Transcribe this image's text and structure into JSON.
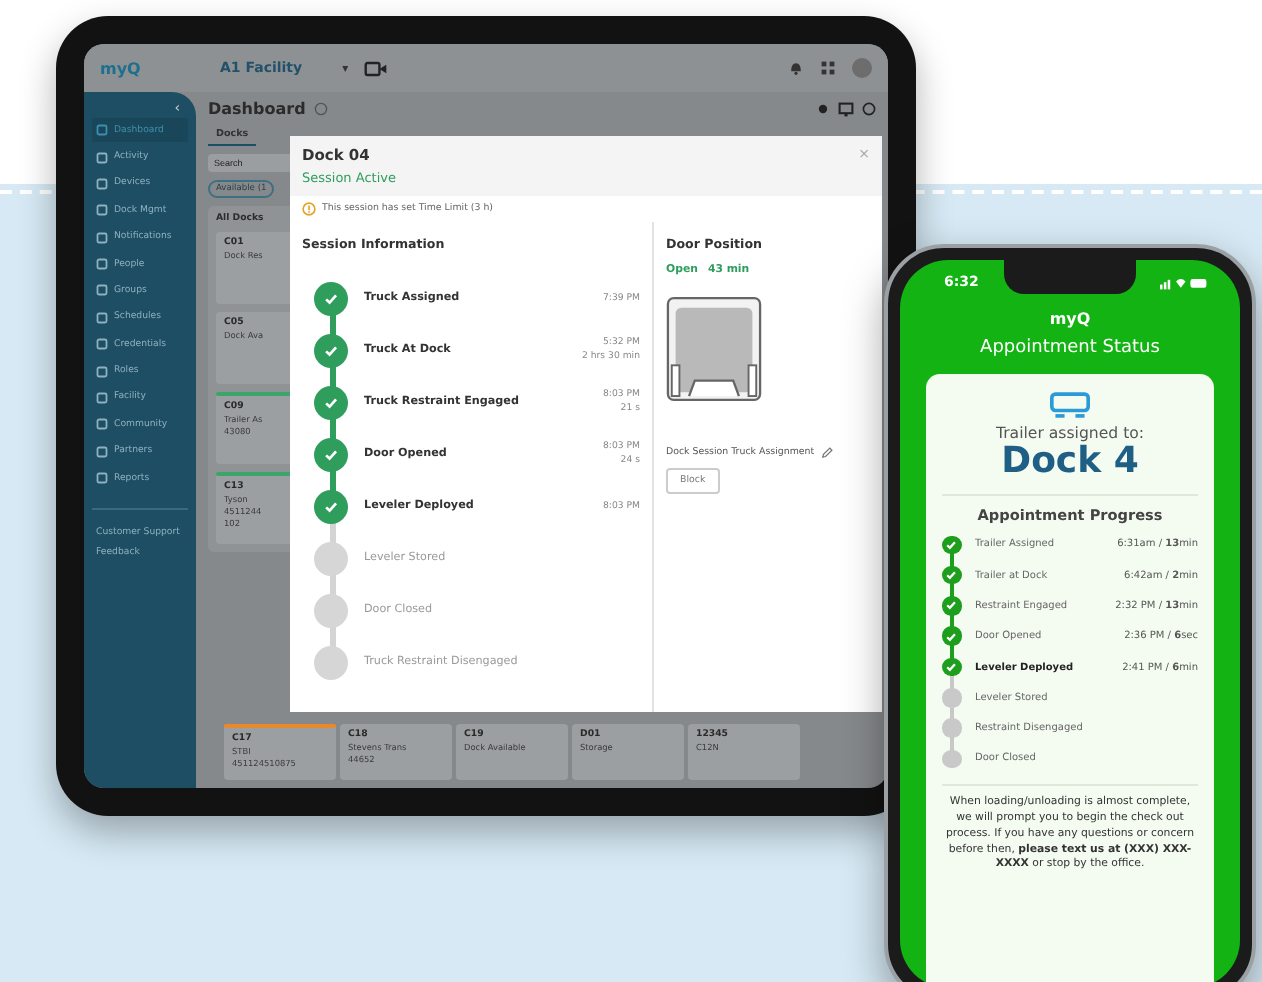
{
  "tablet": {
    "header": {
      "logo": "myQ",
      "facility": "A1 Facility",
      "caret": "▾"
    },
    "sidebar": {
      "collapse": "‹",
      "items": [
        {
          "label": "Dashboard",
          "selected": true
        },
        {
          "label": "Activity",
          "selected": false
        },
        {
          "label": "Devices",
          "selected": false
        },
        {
          "label": "Dock Mgmt",
          "selected": false
        },
        {
          "label": "Notifications",
          "selected": false
        },
        {
          "label": "People",
          "selected": false
        },
        {
          "label": "Groups",
          "selected": false
        },
        {
          "label": "Schedules",
          "selected": false
        },
        {
          "label": "Credentials",
          "selected": false
        },
        {
          "label": "Roles",
          "selected": false
        },
        {
          "label": "Facility",
          "selected": false
        },
        {
          "label": "Community",
          "selected": false
        },
        {
          "label": "Partners",
          "selected": false
        },
        {
          "label": "Reports",
          "selected": false
        }
      ],
      "footer_links": [
        "Customer Support",
        "Feedback"
      ]
    },
    "page_title": "Dashboard",
    "tabs": [
      {
        "label": "Docks",
        "selected": true
      }
    ],
    "search_placeholder": "Search",
    "filter_chip": "Available (1",
    "section_label": "All Docks",
    "dock_cards": [
      {
        "code": "C01",
        "lines": [
          "Dock Res"
        ]
      },
      {
        "code": "C05",
        "lines": [
          "Dock Ava"
        ]
      },
      {
        "code": "C09",
        "lines": [
          "Trailer As",
          "43080"
        ],
        "color": "#3aa66a"
      },
      {
        "code": "C13",
        "lines": [
          "Tyson",
          "4511244",
          "102"
        ],
        "color": "#3aa66a"
      }
    ],
    "bottom_cards": [
      {
        "code": "C17",
        "lines": [
          "STBI",
          "451124510875"
        ],
        "color": "#e8892c"
      },
      {
        "code": "C18",
        "lines": [
          "Stevens Trans",
          "44652"
        ]
      },
      {
        "code": "C19",
        "lines": [
          "Dock Available"
        ]
      },
      {
        "code": "D01",
        "lines": [
          "Storage"
        ]
      },
      {
        "code": "12345",
        "lines": [
          "C12N"
        ]
      }
    ],
    "modal": {
      "title": "Dock 04",
      "status": "Session Active",
      "notice": "This session has set Time Limit (3 h)",
      "close": "×",
      "section": "Session Information",
      "steps": [
        {
          "label": "Truck Assigned",
          "done": true,
          "time": "7:39 PM"
        },
        {
          "label": "Truck At Dock",
          "done": true,
          "time": "5:32 PM",
          "duration": "2 hrs 30 min"
        },
        {
          "label": "Truck Restraint Engaged",
          "done": true,
          "time": "8:03 PM",
          "duration": "21 s"
        },
        {
          "label": "Door Opened",
          "done": true,
          "time": "8:03 PM",
          "duration": "24 s"
        },
        {
          "label": "Leveler Deployed",
          "done": true,
          "time": "8:03 PM"
        },
        {
          "label": "Leveler Stored",
          "done": false
        },
        {
          "label": "Door Closed",
          "done": false
        },
        {
          "label": "Truck Restraint Disengaged",
          "done": false
        }
      ],
      "door_title": "Door Position",
      "door_state": "Open",
      "door_duration": "43 min",
      "assignment_label": "Dock Session Truck Assignment",
      "assignment_button": "Block"
    }
  },
  "phone": {
    "time": "6:32",
    "logo": "myQ",
    "title": "Appointment Status",
    "assigned_label": "Trailer assigned to:",
    "dock": "Dock 4",
    "progress_title": "Appointment Progress",
    "steps": [
      {
        "label": "Trailer Assigned",
        "done": true,
        "current": false,
        "time": "6:31am / **13**min"
      },
      {
        "label": "Trailer at Dock",
        "done": true,
        "current": false,
        "time": "6:42am / **2**min"
      },
      {
        "label": "Restraint Engaged",
        "done": true,
        "current": false,
        "time": "2:32 PM / **13**min"
      },
      {
        "label": "Door Opened",
        "done": true,
        "current": false,
        "time": "2:36 PM / **6**sec"
      },
      {
        "label": "Leveler Deployed",
        "done": true,
        "current": true,
        "time": "2:41 PM / **6**min"
      },
      {
        "label": "Leveler Stored",
        "done": false,
        "current": false
      },
      {
        "label": "Restraint Disengaged",
        "done": false,
        "current": false
      },
      {
        "label": "Door Closed",
        "done": false,
        "current": false
      }
    ],
    "footer": "When loading/unloading is almost complete, we will prompt you to begin the check out process. If you have any questions or concern before then, **please text us at (XXX) XXX-XXXX** or stop by the office."
  }
}
